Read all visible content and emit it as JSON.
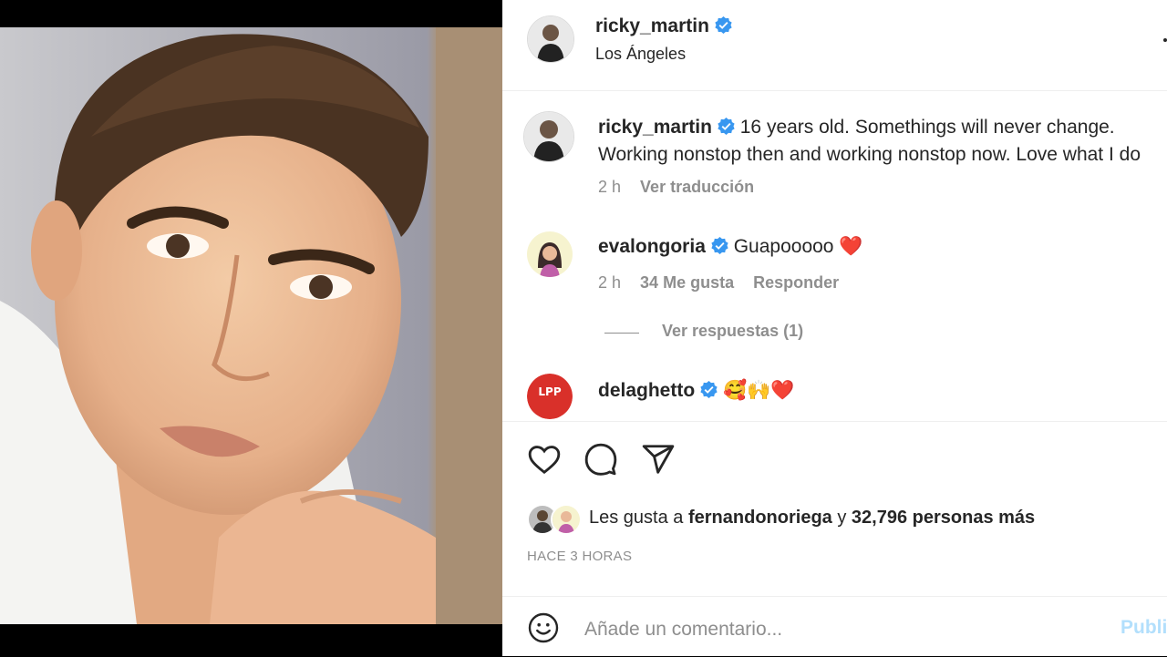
{
  "post": {
    "username": "ricky_martin",
    "location": "Los Ángeles",
    "caption_line1": "16 years old. Somethings will never change.",
    "caption_line2": "Working nonstop then and working nonstop now. Love what I do",
    "caption_time": "2 h",
    "see_translation": "Ver traducción"
  },
  "comments": [
    {
      "username": "evalongoria",
      "text": "Guapooooo",
      "emoji": "❤️",
      "time": "2 h",
      "likes": "34 Me gusta",
      "reply_label": "Responder",
      "view_replies": "Ver respuestas (1)"
    },
    {
      "username": "delaghetto",
      "emoji": "🥰🙌❤️"
    }
  ],
  "likes": {
    "prefix": "Les gusta a",
    "user": "fernandonoriega",
    "joiner": "y",
    "count_text": "32,796 personas más"
  },
  "timestamp": "HACE 3 HORAS",
  "add_comment": {
    "placeholder": "Añade un comentario...",
    "post_label": "Publicar"
  },
  "colors": {
    "verified": "#3897f0",
    "muted": "#8e8e8e",
    "post_button": "#b2dffc"
  },
  "icons": [
    "heart-icon",
    "comment-icon",
    "share-icon",
    "smile-icon",
    "verified-icon"
  ]
}
